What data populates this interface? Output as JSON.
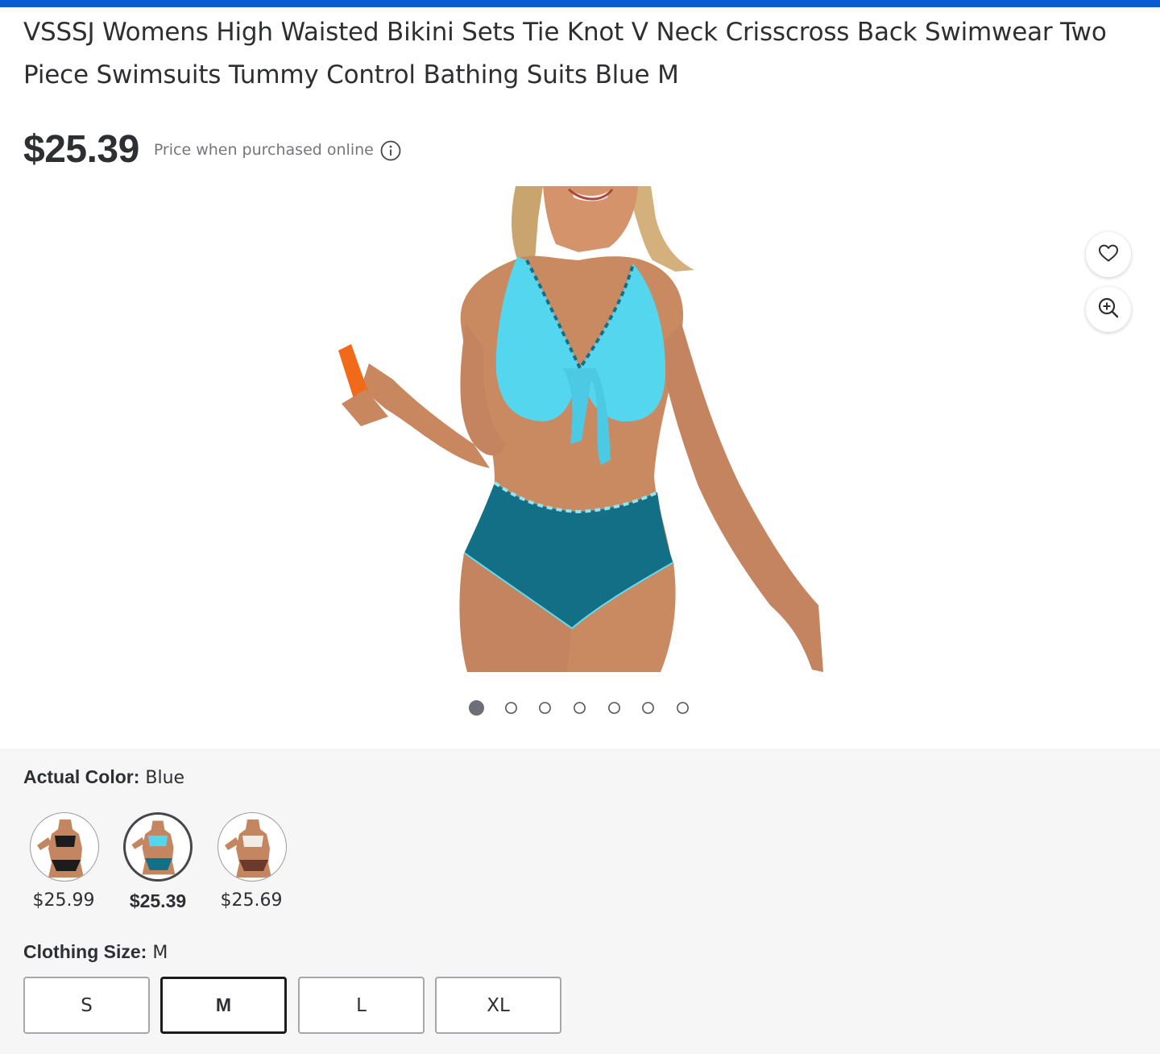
{
  "product": {
    "title": "VSSSJ Womens High Waisted Bikini Sets Tie Knot V Neck Crisscross Back Swimwear Two Piece Swimsuits Tummy Control Bathing Suits Blue M",
    "price": "$25.39",
    "price_note": "Price when purchased online"
  },
  "gallery": {
    "image_count": 7,
    "active_index": 0
  },
  "icons": {
    "info": "info-icon",
    "favorite": "heart-icon",
    "zoom": "zoom-in-icon"
  },
  "color": {
    "label": "Actual Color:",
    "selected": "Blue",
    "swatches": [
      {
        "price": "$25.99",
        "tone": "black"
      },
      {
        "price": "$25.39",
        "tone": "blue",
        "selected": true
      },
      {
        "price": "$25.69",
        "tone": "brown"
      }
    ]
  },
  "size": {
    "label": "Clothing Size:",
    "selected": "M",
    "options": [
      {
        "label": "S"
      },
      {
        "label": "M",
        "selected": true
      },
      {
        "label": "L"
      },
      {
        "label": "XL"
      }
    ]
  },
  "colors": {
    "brand_blue": "#0a5bd3",
    "top_light": "#55d6ef",
    "bottom_teal": "#136f86",
    "skin": "#c98a62"
  }
}
